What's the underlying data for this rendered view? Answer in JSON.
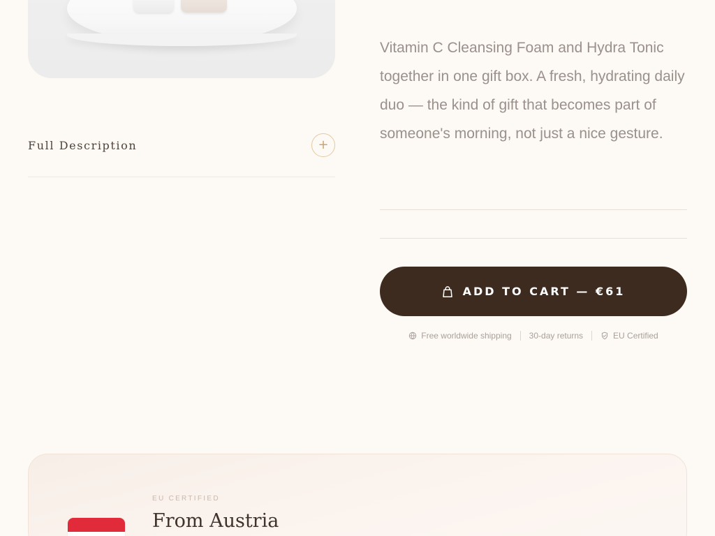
{
  "product": {
    "description": "Vitamin C Cleansing Foam and Hydra Tonic together in one gift box. A fresh, hydrating daily duo — the kind of gift that becomes part of someone's morning, not just a nice gesture."
  },
  "details": {
    "full_description_label": "Full Description",
    "toggle_symbol": "+"
  },
  "cart": {
    "label": "ADD TO CART — €61",
    "icon": "shopping-bag-icon",
    "accent": "#3d2b1f"
  },
  "trust": {
    "items": [
      {
        "icon": "globe-icon",
        "label": "Free worldwide shipping"
      },
      {
        "icon": "",
        "label": "30-day returns"
      },
      {
        "icon": "shield-icon",
        "label": "EU Certified"
      }
    ]
  },
  "origin": {
    "kicker": "EU CERTIFIED",
    "title": "From Austria",
    "flag_icon": "austria-flag-icon"
  },
  "colors": {
    "page_background": "#fdf9f4",
    "text_muted": "#9a908c",
    "accent_gold": "#c8a572",
    "flag_red": "#e12b3b"
  }
}
